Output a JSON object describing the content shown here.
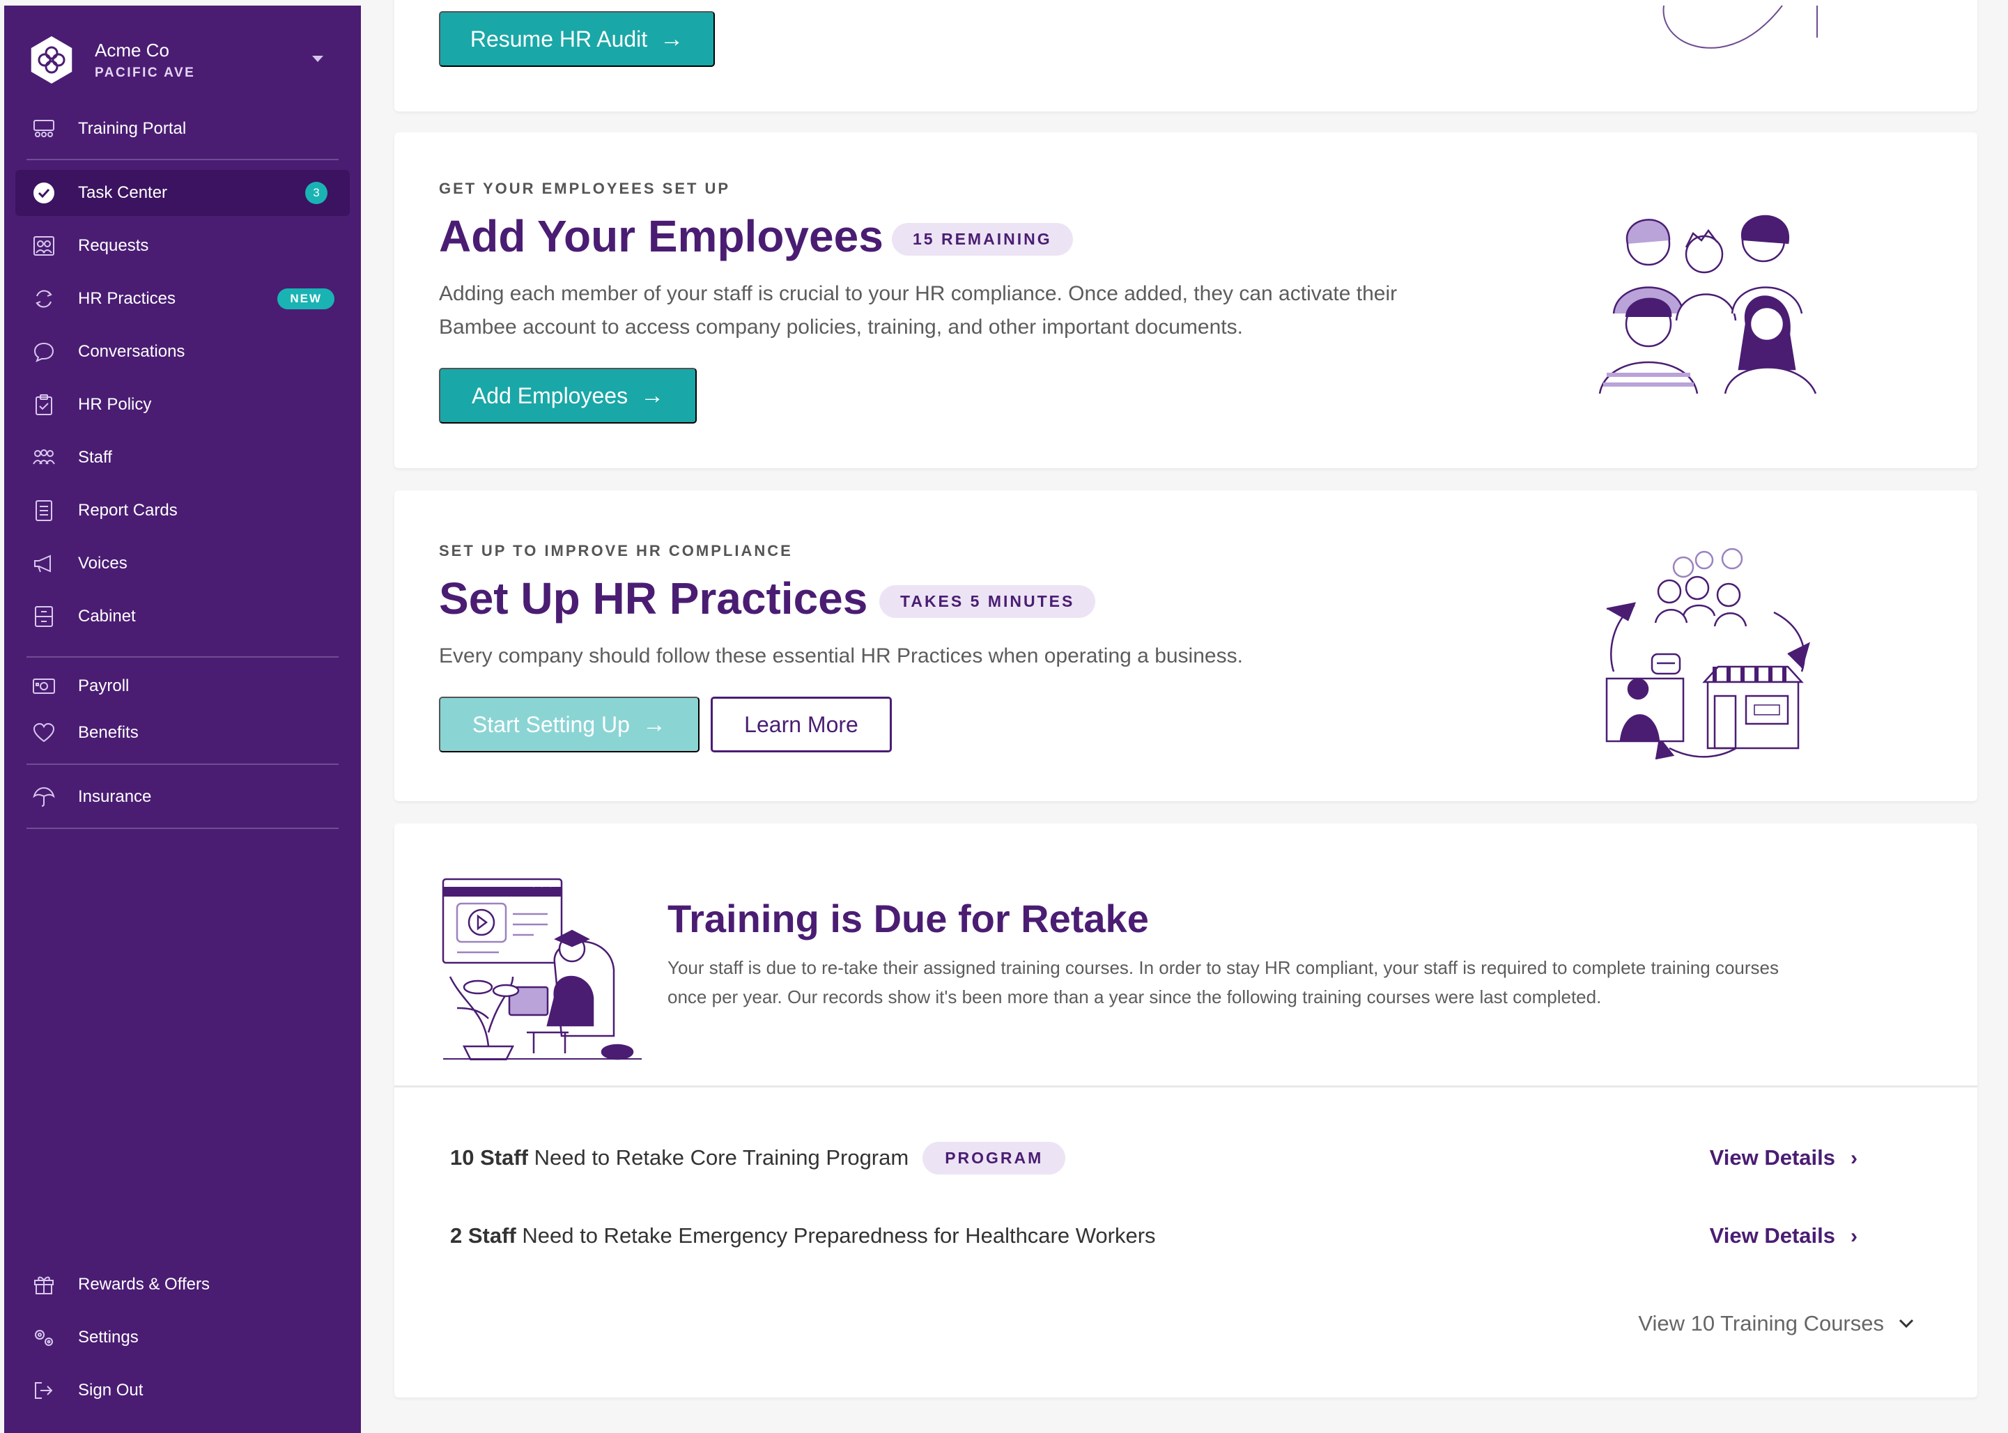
{
  "sidebar": {
    "company": "Acme Co",
    "location": "PACIFIC AVE",
    "items": [
      {
        "label": "Training Portal"
      },
      {
        "label": "Task Center",
        "badge": "3"
      },
      {
        "label": "Requests"
      },
      {
        "label": "HR Practices",
        "tag": "NEW"
      },
      {
        "label": "Conversations"
      },
      {
        "label": "HR Policy"
      },
      {
        "label": "Staff"
      },
      {
        "label": "Report Cards"
      },
      {
        "label": "Voices"
      },
      {
        "label": "Cabinet"
      },
      {
        "label": "Payroll"
      },
      {
        "label": "Benefits"
      },
      {
        "label": "Insurance"
      },
      {
        "label": "Rewards & Offers"
      },
      {
        "label": "Settings"
      },
      {
        "label": "Sign Out"
      }
    ]
  },
  "audit": {
    "button": "Resume HR Audit"
  },
  "employees": {
    "eyebrow": "GET YOUR EMPLOYEES SET UP",
    "title": "Add Your Employees",
    "pill": "15 REMAINING",
    "desc_1": "Adding each member of your staff is crucial to your HR compliance. Once added, they can activate their",
    "desc_2": "Bambee account to access company policies, training, and other important  documents.",
    "button": "Add Employees"
  },
  "practices": {
    "eyebrow": "SET UP TO IMPROVE HR COMPLIANCE",
    "title": "Set Up HR Practices",
    "pill": "TAKES 5 MINUTES",
    "desc": "Every company should follow these essential HR Practices when operating a business.",
    "button_start": "Start Setting Up",
    "button_learn": "Learn More"
  },
  "training": {
    "title": "Training is Due for Retake",
    "desc_1": "Your staff is due to re-take their assigned training courses. In order to stay HR compliant, your staff is required to complete training courses",
    "desc_2": "once per year. Our records show it's been more than a year since the following training courses were last completed.",
    "rows": [
      {
        "count": "10 Staff",
        "text": " Need to Retake Core Training Program",
        "pill": "PROGRAM",
        "link": "View Details"
      },
      {
        "count": "2 Staff",
        "text": " Need to Retake Emergency Preparedness for Healthcare Workers",
        "link": "View Details"
      }
    ],
    "view_all": "View 10 Training Courses"
  },
  "colors": {
    "brand_purple": "#4a1d73",
    "teal": "#1aa7a7",
    "badge_teal": "#1ab3b3"
  }
}
